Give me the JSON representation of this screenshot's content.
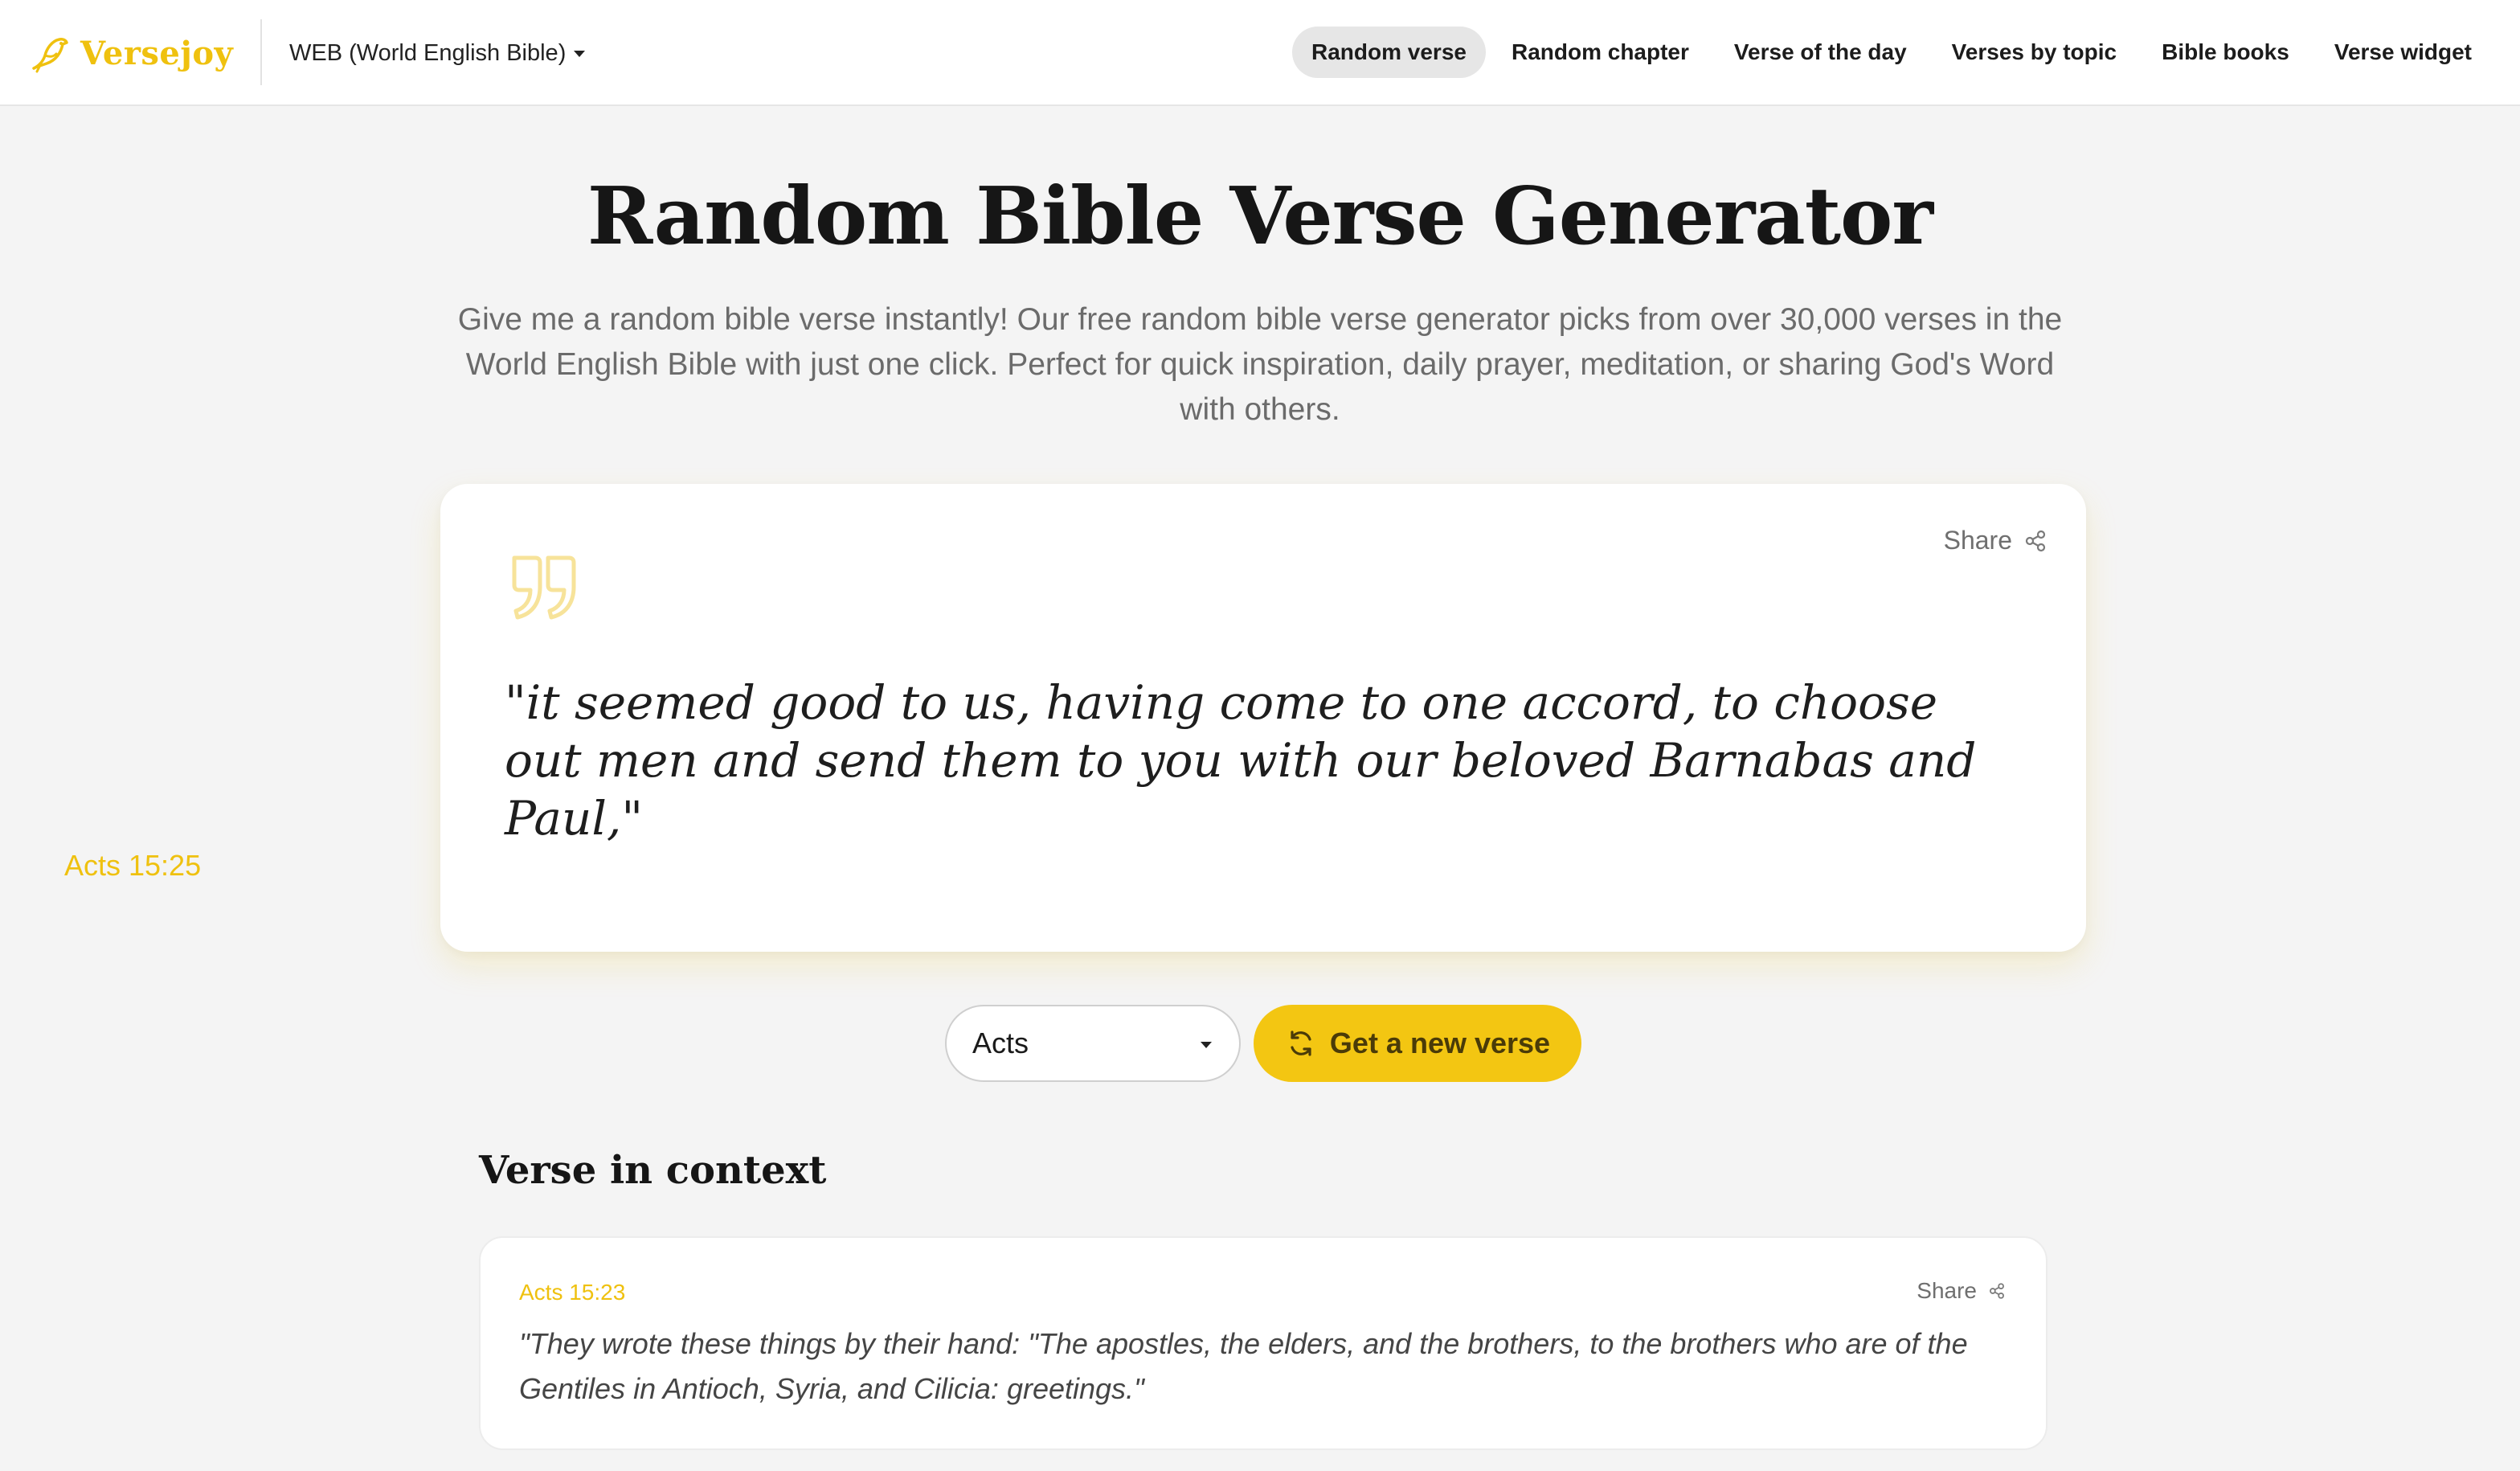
{
  "brand": {
    "name": "Versejoy",
    "color": "#efc10f",
    "logo_icon": "bird-icon"
  },
  "version_selector": {
    "label": "WEB (World English Bible)"
  },
  "nav": {
    "items": [
      {
        "label": "Random verse",
        "active": true
      },
      {
        "label": "Random chapter",
        "active": false
      },
      {
        "label": "Verse of the day",
        "active": false
      },
      {
        "label": "Verses by topic",
        "active": false
      },
      {
        "label": "Bible books",
        "active": false
      },
      {
        "label": "Verse widget",
        "active": false
      }
    ]
  },
  "hero": {
    "title": "Random Bible Verse Generator",
    "intro": "Give me a random bible verse instantly! Our free random bible verse generator picks from over 30,000 verses in the World English Bible with just one click. Perfect for quick inspiration, daily prayer, meditation, or sharing God's Word with others."
  },
  "verse_card": {
    "share_label": "Share",
    "text": "\"it seemed good to us, having come to one accord, to choose out men and send them to you with our beloved Barnabas and Paul,\"",
    "reference": "Acts 15:25"
  },
  "controls": {
    "book_select_value": "Acts",
    "new_verse_label": "Get a new verse"
  },
  "context": {
    "heading": "Verse in context",
    "items": [
      {
        "reference": "Acts 15:23",
        "share_label": "Share",
        "text": "\"They wrote these things by their hand: \"The apostles, the elders, and the brothers, to the brothers who are of the Gentiles in Antioch, Syria, and Cilicia: greetings.\""
      }
    ]
  },
  "colors": {
    "accent": "#efc10f",
    "button": "#f3c612",
    "background": "#f4f4f4",
    "card": "#ffffff"
  }
}
